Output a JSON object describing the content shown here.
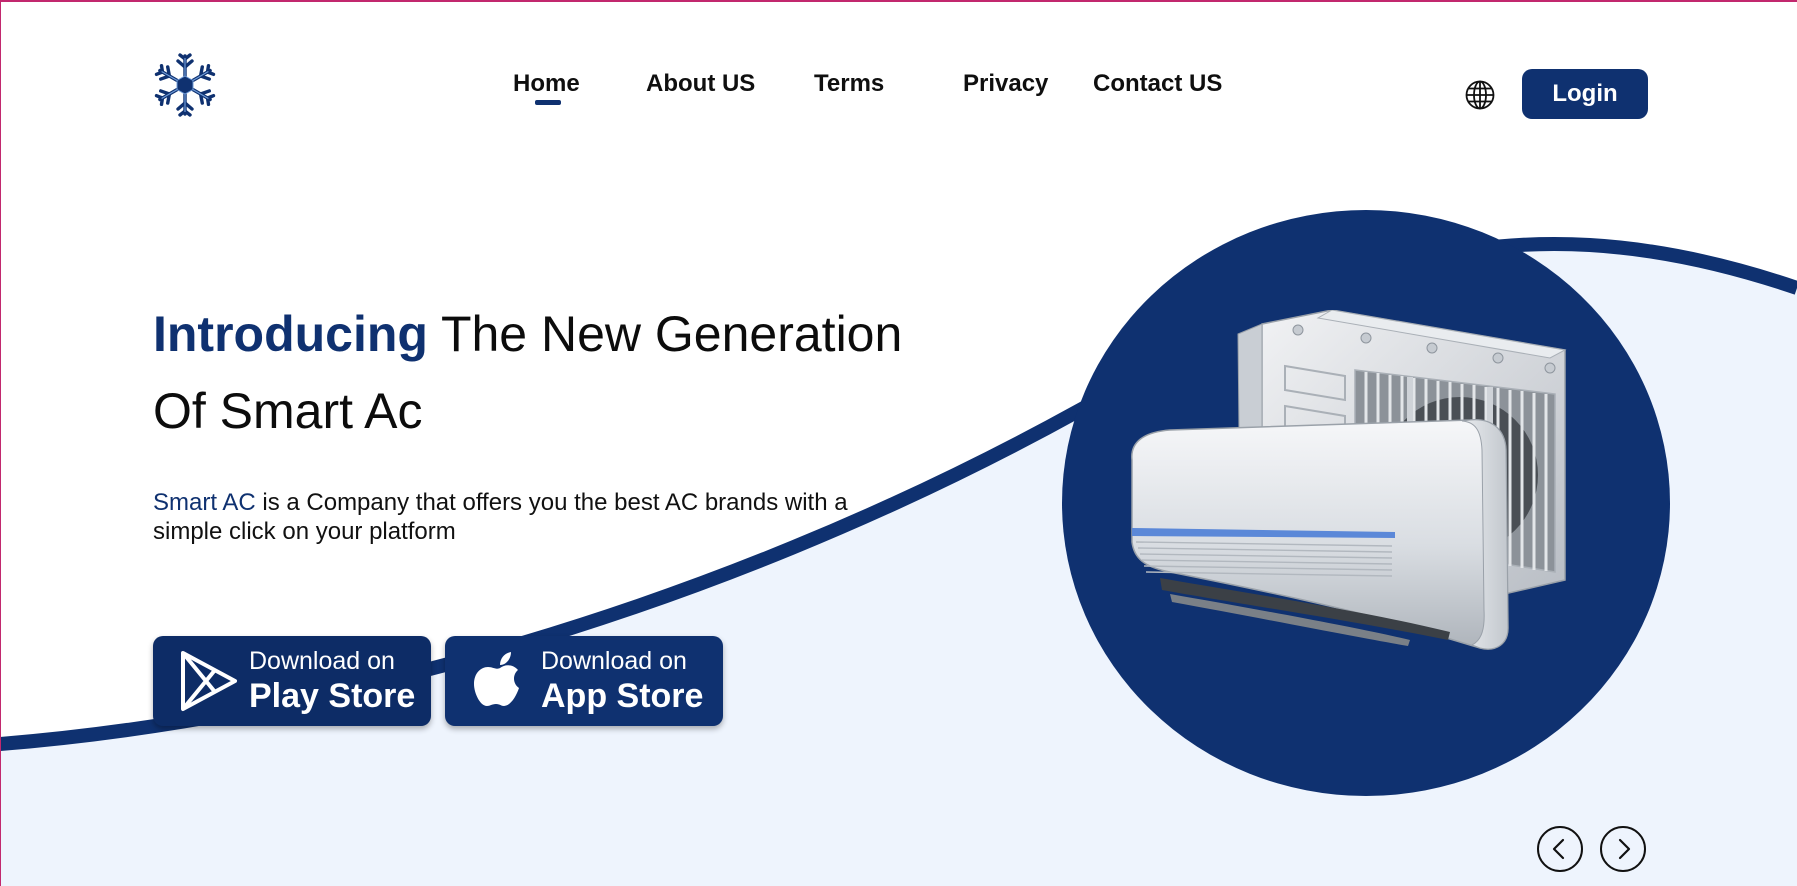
{
  "header": {
    "logo_icon": "snowflake-icon",
    "nav": [
      {
        "label": "Home",
        "active": true
      },
      {
        "label": "About US"
      },
      {
        "label": "Terms"
      },
      {
        "label": "Privacy"
      },
      {
        "label": "Contact US"
      }
    ],
    "language_icon": "globe-icon",
    "login_label": "Login"
  },
  "hero": {
    "title_accent": "Introducing",
    "title_rest": " The New Generation Of Smart Ac",
    "desc_brand": "Smart AC",
    "desc_rest": " is a Company that offers you the best AC brands with a simple click on your platform",
    "play_store": {
      "line1": "Download on",
      "line2": "Play Store",
      "icon": "play-store-icon"
    },
    "app_store": {
      "line1": "Download on",
      "line2": "App Store",
      "icon": "apple-icon"
    },
    "image": "air-conditioner-image"
  },
  "carousel": {
    "prev_icon": "chevron-left-icon",
    "next_icon": "chevron-right-icon"
  },
  "colors": {
    "primary": "#0f3170",
    "background_wave": "#eef4fd",
    "frame": "#c2286e"
  }
}
